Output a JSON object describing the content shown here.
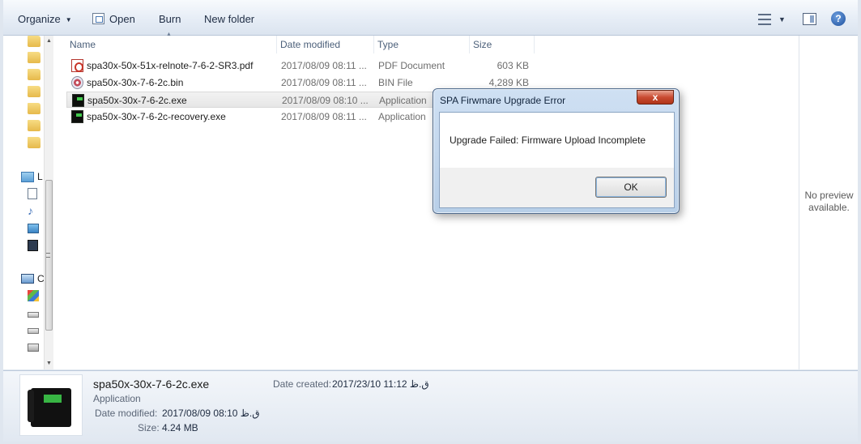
{
  "toolbar": {
    "organize": "Organize",
    "open": "Open",
    "burn": "Burn",
    "new_folder": "New folder",
    "help": "?"
  },
  "columns": {
    "name": "Name",
    "date": "Date modified",
    "type": "Type",
    "size": "Size"
  },
  "files": [
    {
      "name": "spa30x-50x-51x-relnote-7-6-2-SR3.pdf",
      "date": "2017/08/09 08:11 ...",
      "type": "PDF Document",
      "size": "603 KB",
      "icon": "pdf-icon"
    },
    {
      "name": "spa50x-30x-7-6-2c.bin",
      "date": "2017/08/09 08:11 ...",
      "type": "BIN File",
      "size": "4,289 KB",
      "icon": "bin-file-icon"
    },
    {
      "name": "spa50x-30x-7-6-2c.exe",
      "date": "2017/08/09 08:10 ...",
      "type": "Application",
      "size": "",
      "icon": "exe-phone-icon"
    },
    {
      "name": "spa50x-30x-7-6-2c-recovery.exe",
      "date": "2017/08/09 08:11 ...",
      "type": "Application",
      "size": "",
      "icon": "exe-phone-icon"
    }
  ],
  "nav": {
    "libraries_initial": "L",
    "computer_initial": "C"
  },
  "preview": {
    "line1": "No preview",
    "line2": "available."
  },
  "details": {
    "name": "spa50x-30x-7-6-2c.exe",
    "type": "Application",
    "date_modified_label": "Date modified:",
    "date_modified_value": "2017/08/09 ق.ظ 08:10",
    "size_label": "Size:",
    "size_value": "4.24 MB",
    "date_created_label": "Date created:",
    "date_created_value": "2017/23/10 ق.ظ 11:12"
  },
  "dialog": {
    "title": "SPA Firwmare Upgrade Error",
    "message": "Upgrade Failed: Firmware Upload Incomplete",
    "ok": "OK",
    "close": "x"
  },
  "colors": {
    "toolbar_bg": "#e6edf6",
    "selection": "#e6e6e6",
    "close_button": "#c94b32",
    "phone_screen": "#38b544"
  }
}
